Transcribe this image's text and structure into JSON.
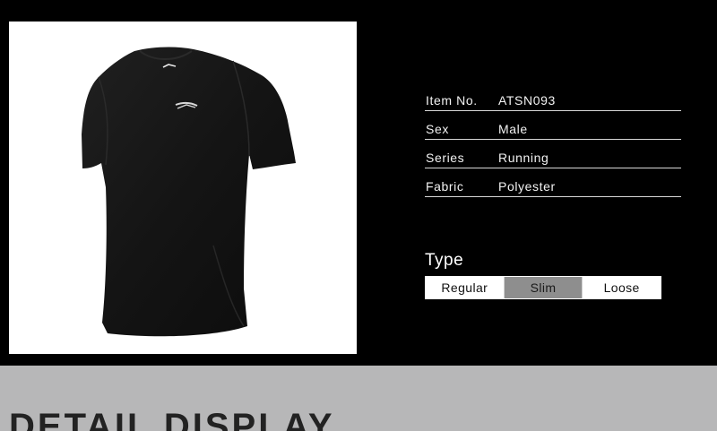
{
  "specs": [
    {
      "key": "Item No.",
      "value": "ATSN093"
    },
    {
      "key": "Sex",
      "value": "Male"
    },
    {
      "key": "Series",
      "value": "Running"
    },
    {
      "key": "Fabric",
      "value": "Polyester"
    }
  ],
  "type_section": {
    "title": "Type",
    "options": [
      "Regular",
      "Slim",
      "Loose"
    ],
    "selected": "Slim"
  },
  "detail": {
    "title": "DETAIL DISPLAY"
  },
  "product_image": {
    "subject": "black short-sleeve running t-shirt",
    "shirt_color": "#141414",
    "logo_icon": "li-ning-logo-icon"
  },
  "colors": {
    "background_dark": "#000000",
    "panel_light": "#ffffff",
    "bottom_band": "#b7b7b8",
    "selected_option": "#8e8e8e"
  }
}
